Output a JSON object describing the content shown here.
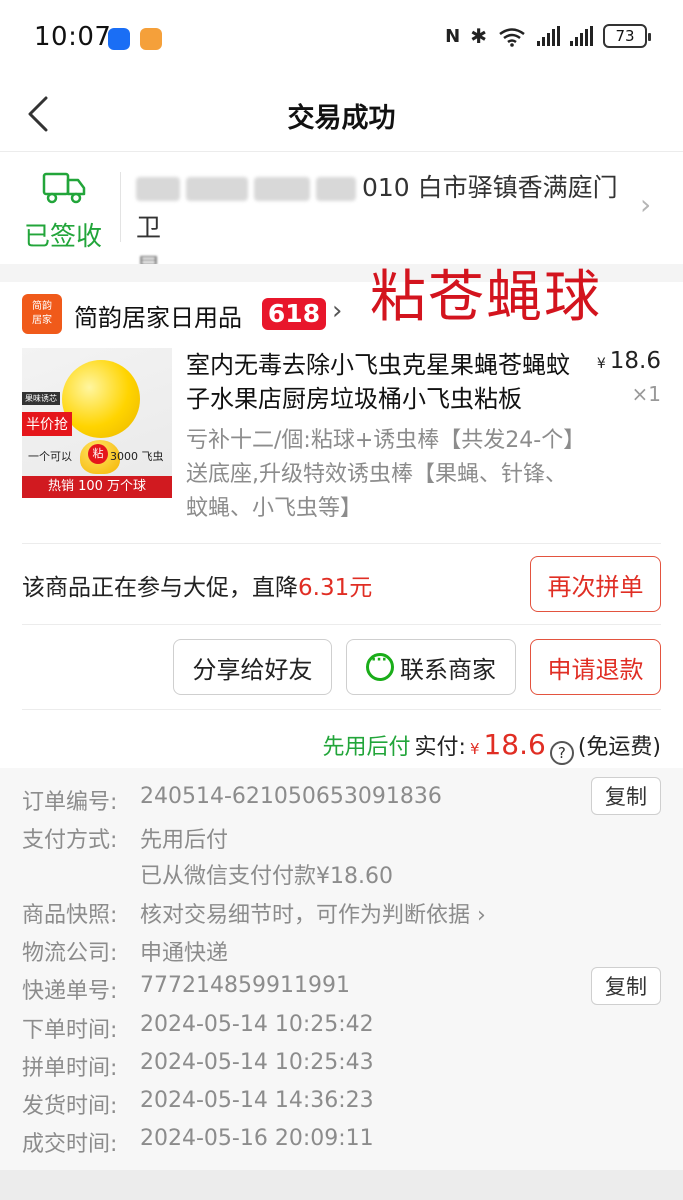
{
  "status_bar": {
    "time": "10:07",
    "battery": "73",
    "icons": [
      "notification-app-icon",
      "news-app-icon",
      "nfc-icon",
      "bluetooth-icon",
      "wifi-6-icon",
      "signal-icon",
      "signal-icon",
      "battery-icon"
    ]
  },
  "nav": {
    "title": "交易成功",
    "back_icon": "chevron-left-icon"
  },
  "delivery": {
    "status": "已签收",
    "address_visible": "010 白市驿镇香满庭门卫",
    "address_line2": "星",
    "status_color": "#22a53a"
  },
  "overlay_text": "粘苍蝇球",
  "shop": {
    "logo_line1": "简韵",
    "logo_line2": "居家",
    "name": "简韵居家日用品",
    "badge": "618"
  },
  "product": {
    "title": "室内无毒去除小飞虫克星果蝇苍蝇蚊子水果店厨房垃圾桶小飞虫粘板",
    "spec": "亏补十二/個:粘球+诱虫棒【共发24-个】送底座,升级特效诱虫棒【果蝇、针锋、蚊蝇、小飞虫等】",
    "currency": "¥",
    "price": "18.6",
    "quantity": "×1",
    "image": {
      "tag_top": "果味诱芯",
      "tag_half": "半价抢",
      "line_prefix": "一个可以",
      "line_stick": "粘",
      "line_suffix": "3000 飞虫",
      "footer": "热销 100 万个球"
    }
  },
  "promo": {
    "text": "该商品正在参与大促，直降",
    "amount": "6.31元"
  },
  "buttons": {
    "buy_again": "再次拼单",
    "share": "分享给好友",
    "contact": "联系商家",
    "refund": "申请退款"
  },
  "payment": {
    "pay_later": "先用后付",
    "paid_label": "实付:",
    "currency": "¥",
    "amount": "18.6",
    "help": "?",
    "shipping": "(免运费)"
  },
  "order_info": {
    "order_no_label": "订单编号:",
    "order_no": "240514-621050653091836",
    "copy": "复制",
    "pay_method_label": "支付方式:",
    "pay_method": "先用后付",
    "pay_detail": "已从微信支付付款¥18.60",
    "snapshot_label": "商品快照:",
    "snapshot": "核对交易细节时，可作为判断依据",
    "courier_label": "物流公司:",
    "courier": "申通快递",
    "tracking_label": "快递单号:",
    "tracking_no": "777214859911991",
    "order_time_label": "下单时间:",
    "order_time": "2024-05-14 10:25:42",
    "group_time_label": "拼单时间:",
    "group_time": "2024-05-14 10:25:43",
    "ship_time_label": "发货时间:",
    "ship_time": "2024-05-14 14:36:23",
    "deal_time_label": "成交时间:",
    "deal_time": "2024-05-16 20:09:11"
  },
  "colors": {
    "accent_red": "#e02e24",
    "green": "#22a53a",
    "badge_red": "#e8162b"
  }
}
